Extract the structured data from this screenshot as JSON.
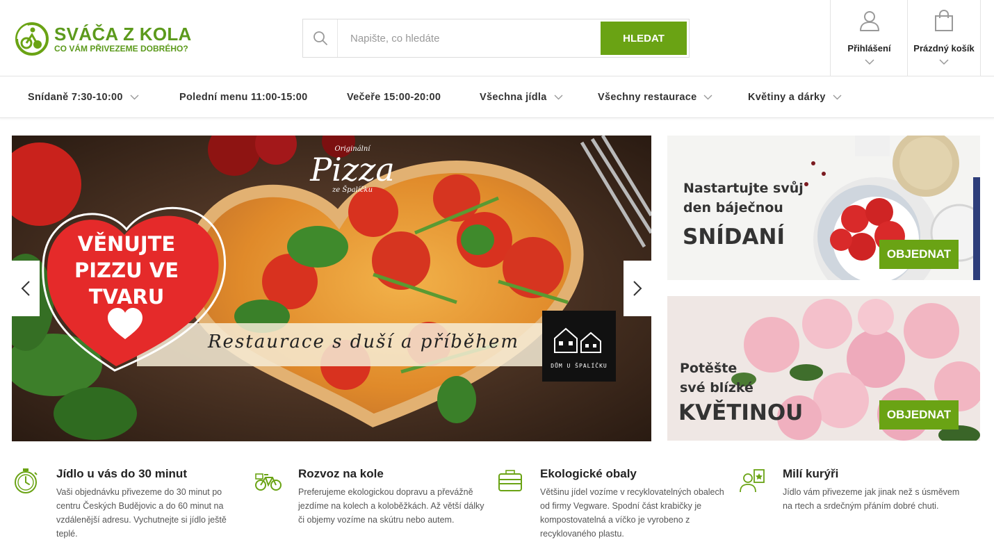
{
  "brand": {
    "title": "SVÁČA Z KOLA",
    "tagline": "CO VÁM PŘIVEZEME DOBRÉHO?",
    "badge_text": "SVÁČA Z KOLA",
    "accent": "#6aa314"
  },
  "search": {
    "placeholder": "Napište, co hledáte",
    "button": "HLEDAT"
  },
  "header": {
    "login_label": "Přihlášení",
    "cart_label": "Prázdný košík"
  },
  "nav": [
    {
      "label": "Snídaně 7:30-10:00",
      "has_dropdown": true
    },
    {
      "label": "Polední menu 11:00-15:00",
      "has_dropdown": false
    },
    {
      "label": "Večeře 15:00-20:00",
      "has_dropdown": false
    },
    {
      "label": "Všechna jídla",
      "has_dropdown": true
    },
    {
      "label": "Všechny restaurace",
      "has_dropdown": true
    },
    {
      "label": "Květiny a dárky",
      "has_dropdown": true
    }
  ],
  "hero": {
    "heart_line1": "VĚNUJTE",
    "heart_line2": "PIZZU VE",
    "heart_line3": "TVARU",
    "script": "Restaurace s duší a příběhem",
    "pizza_small": "Originální",
    "pizza_big": "Pizza",
    "pizza_sub": "ze Špalíčku",
    "restaurant_logo_text": "DŮM U ŠPALÍČKU"
  },
  "promos": [
    {
      "line1": "Nastartujte svůj",
      "line2": "den báječnou",
      "big": "SNÍDANÍ",
      "button": "OBJEDNAT"
    },
    {
      "line1": "Potěšte",
      "line2": "své blízké",
      "big": "KVĚTINOU",
      "button": "OBJEDNAT"
    }
  ],
  "features": [
    {
      "title": "Jídlo u vás do 30 minut",
      "text": "Vaši objednávku přivezeme do 30 minut po centru Českých Budějovic a do 60 minut na vzdálenější adresu. Vychutnejte si jídlo ještě teplé.",
      "icon": "stopwatch-icon"
    },
    {
      "title": "Rozvoz na kole",
      "text": "Preferujeme ekologickou dopravu a převážně jezdíme na kolech a koloběžkách. Až větší dálky či objemy vozíme na skútru nebo autem.",
      "icon": "bicycle-icon"
    },
    {
      "title": "Ekologické obaly",
      "text": "Většinu jídel vozíme v recyklovatelných obalech od firmy Vegware. Spodní část krabičky je kompostovatelná a víčko je vyrobeno z recyklovaného plastu.",
      "icon": "food-box-icon"
    },
    {
      "title": "Milí kurýři",
      "text": "Jídlo vám přivezeme jak jinak než s úsměvem na rtech a srdečným přáním dobré chuti.",
      "icon": "courier-icon"
    }
  ]
}
